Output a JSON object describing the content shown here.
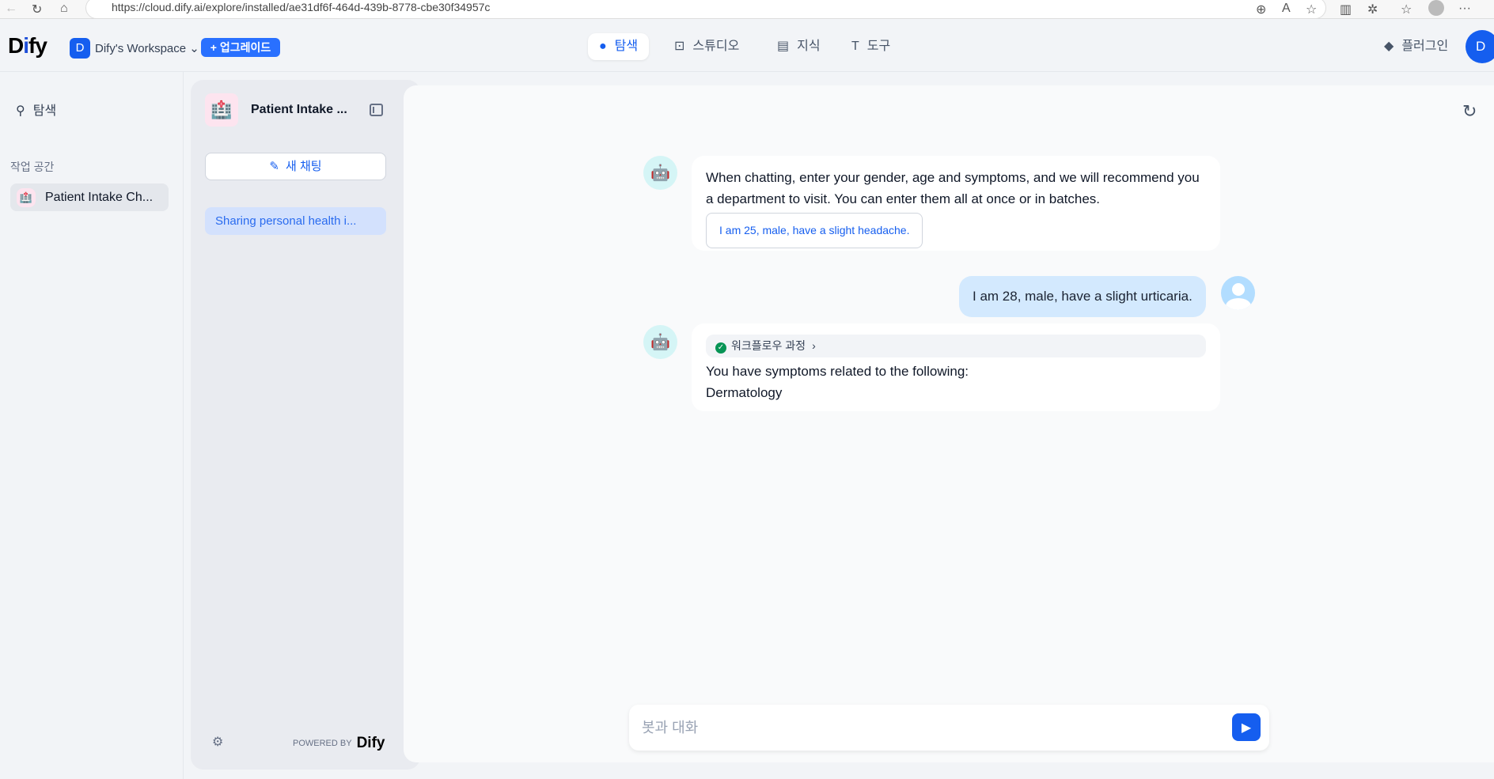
{
  "browser": {
    "url": "https://cloud.dify.ai/explore/installed/ae31df6f-464d-439b-8778-cbe30f34957c"
  },
  "header": {
    "logo": "Dify",
    "workspace_initial": "D",
    "workspace_name": "Dify's Workspace",
    "upgrade_label": "+ 업그레이드",
    "nav": [
      {
        "label": "탐색",
        "icon": "explore-icon"
      },
      {
        "label": "스튜디오",
        "icon": "robot-icon"
      },
      {
        "label": "지식",
        "icon": "book-icon"
      },
      {
        "label": "도구",
        "icon": "hammer-icon"
      }
    ],
    "plugins_label": "플러그인",
    "user_initial": "D"
  },
  "sidebar": {
    "explore_label": "탐색",
    "workspace_section": "작업 공간",
    "apps": [
      {
        "label": "Patient Intake Ch..."
      }
    ]
  },
  "app_panel": {
    "title": "Patient Intake ...",
    "new_chat_label": "새 채팅",
    "conversations": [
      "Sharing personal health i..."
    ],
    "powered_by": "POWERED BY",
    "powered_logo": "Dify"
  },
  "chat": {
    "opening": "When chatting, enter your gender, age and symptoms, and we will recommend you a department to visit. You can enter them all at once or in batches.",
    "suggestion": "I am 25, male, have a slight headache.",
    "user_message": "I am 28, male, have a slight urticaria.",
    "workflow_label": "워크플로우 과정",
    "reply_line1": "You have symptoms related to the following:",
    "reply_line2": "Dermatology",
    "input_placeholder": "봇과 대화"
  },
  "colors": {
    "accent": "#155eef"
  }
}
